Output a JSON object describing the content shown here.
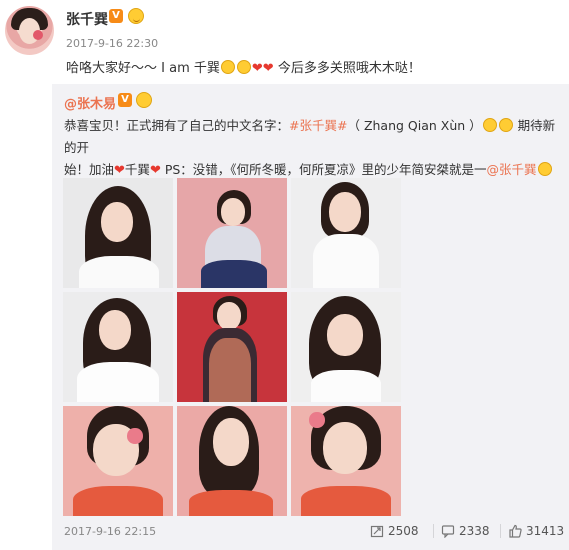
{
  "author": {
    "name": "张千巽",
    "badge": "V",
    "timestamp": "2017-9-16 22:30"
  },
  "post": {
    "text_before": "哈咯大家好～～ I am 千巽",
    "text_after": " 今后多多关照哦木木哒！"
  },
  "repost": {
    "author": "@张木易",
    "badge": "V",
    "line1_a": "恭喜宝贝！正式拥有了自己的中文名字：",
    "hashtag": "#张千巽#",
    "line1_b": "（ Zhang Qian Xùn ）",
    "line1_c": " 期待新的开",
    "line2_a": "始！加油",
    "line2_b": "千巽",
    "line2_c": " PS：没错，《何所冬暖，何所夏凉》里的少年简安桀就是一",
    "mention": "@张千巽",
    "timestamp": "2017-9-16 22:15",
    "stats": {
      "reposts": "2508",
      "comments": "2338",
      "likes": "31413"
    }
  },
  "colors": {
    "link": "#eb7350",
    "repost_bg": "#f2f2f5",
    "vip": "#f78b17"
  }
}
